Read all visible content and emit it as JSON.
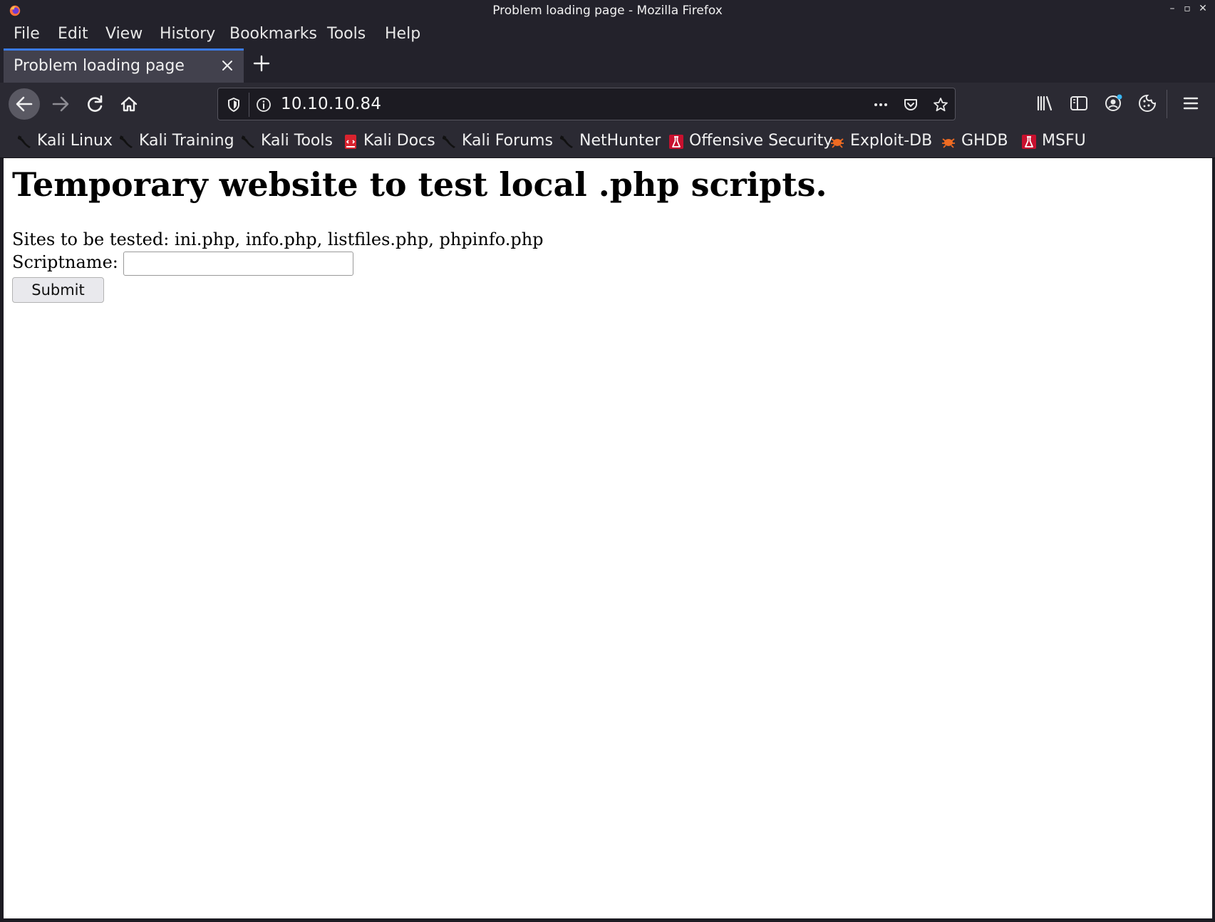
{
  "window": {
    "title": "Problem loading page - Mozilla Firefox",
    "controls": {
      "minimize": "–",
      "maximize": "▫",
      "close": "✕"
    }
  },
  "menubar": {
    "items": [
      "File",
      "Edit",
      "View",
      "History",
      "Bookmarks",
      "Tools",
      "Help"
    ]
  },
  "tabs": [
    {
      "label": "Problem loading page",
      "active": true
    }
  ],
  "urlbar": {
    "url": "10.10.10.84"
  },
  "bookmarks": [
    {
      "label": "Kali Linux",
      "icon": "kali-dragon-icon"
    },
    {
      "label": "Kali Training",
      "icon": "kali-dragon-icon"
    },
    {
      "label": "Kali Tools",
      "icon": "kali-dragon-icon"
    },
    {
      "label": "Kali Docs",
      "icon": "kali-docs-icon"
    },
    {
      "label": "Kali Forums",
      "icon": "kali-dragon-icon"
    },
    {
      "label": "NetHunter",
      "icon": "kali-dragon-icon"
    },
    {
      "label": "Offensive Security",
      "icon": "offsec-flask-icon"
    },
    {
      "label": "Exploit-DB",
      "icon": "exploitdb-bug-icon"
    },
    {
      "label": "GHDB",
      "icon": "exploitdb-bug-icon"
    },
    {
      "label": "MSFU",
      "icon": "offsec-flask-icon"
    }
  ],
  "page": {
    "heading": "Temporary website to test local .php scripts.",
    "sites_line": "Sites to be tested: ini.php, info.php, listfiles.php, phpinfo.php",
    "script_label": "Scriptname:",
    "script_value": "",
    "submit_label": "Submit"
  },
  "colors": {
    "chrome_dark": "#23222b",
    "toolbar": "#2b2a33",
    "active_tab": "#42414d",
    "tab_accent": "#3b7ae6",
    "page_bg": "#ffffff"
  }
}
